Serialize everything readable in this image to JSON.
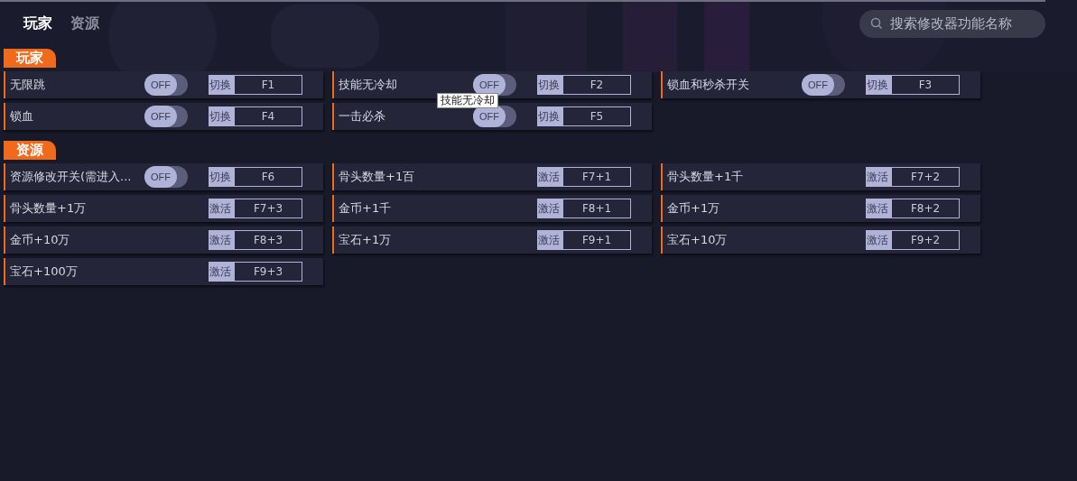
{
  "tabs": [
    {
      "label": "玩家",
      "selected": true
    },
    {
      "label": "资源",
      "selected": false
    }
  ],
  "search": {
    "placeholder": "搜索修改器功能名称"
  },
  "sections": [
    {
      "title": "玩家",
      "items": [
        {
          "name": "无限跳",
          "kind": "toggle",
          "on": false,
          "state": "OFF",
          "action": "切换",
          "key": "F1"
        },
        {
          "name": "技能无冷却",
          "kind": "toggle",
          "on": false,
          "state": "OFF",
          "action": "切换",
          "key": "F2"
        },
        {
          "name": "锁血和秒杀开关",
          "kind": "toggle",
          "on": false,
          "state": "OFF",
          "action": "切换",
          "key": "F3"
        },
        {
          "name": "锁血",
          "kind": "toggle",
          "on": false,
          "state": "OFF",
          "action": "切换",
          "key": "F4"
        },
        {
          "name": "一击必杀",
          "kind": "toggle",
          "on": false,
          "state": "OFF",
          "action": "切换",
          "key": "F5"
        }
      ]
    },
    {
      "title": "资源",
      "items": [
        {
          "name": "资源修改开关(需进入...",
          "kind": "toggle",
          "on": false,
          "state": "OFF",
          "action": "切换",
          "key": "F6"
        },
        {
          "name": "骨头数量+1百",
          "kind": "button",
          "action": "激活",
          "key": "F7+1"
        },
        {
          "name": "骨头数量+1千",
          "kind": "button",
          "action": "激活",
          "key": "F7+2"
        },
        {
          "name": "骨头数量+1万",
          "kind": "button",
          "action": "激活",
          "key": "F7+3"
        },
        {
          "name": "金币+1千",
          "kind": "button",
          "action": "激活",
          "key": "F8+1"
        },
        {
          "name": "金币+1万",
          "kind": "button",
          "action": "激活",
          "key": "F8+2"
        },
        {
          "name": "金币+10万",
          "kind": "button",
          "action": "激活",
          "key": "F8+3"
        },
        {
          "name": "宝石+1万",
          "kind": "button",
          "action": "激活",
          "key": "F9+1"
        },
        {
          "name": "宝石+10万",
          "kind": "button",
          "action": "激活",
          "key": "F9+2"
        },
        {
          "name": "宝石+100万",
          "kind": "button",
          "action": "激活",
          "key": "F9+3"
        }
      ]
    }
  ],
  "tooltip": {
    "text": "技能无冷却"
  }
}
